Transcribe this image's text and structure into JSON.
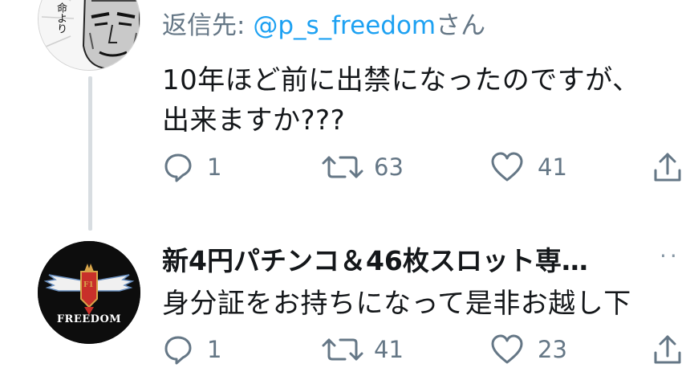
{
  "tweet1": {
    "reply_prefix": "返信先: ",
    "reply_mention": "@p_s_freedom",
    "reply_suffix": "さん",
    "avatar_text": "命より",
    "text_line1": "10年ほど前に出禁になったのですが、",
    "text_line2": "出来ますか???",
    "actions": {
      "reply_icon": "reply-icon",
      "reply_count": "1",
      "retweet_icon": "retweet-icon",
      "retweet_count": "63",
      "like_icon": "heart-icon",
      "like_count": "41",
      "share_icon": "share-icon"
    }
  },
  "tweet2": {
    "display_name": "新4円パチンコ＆46枚スロット専…",
    "text_line1": "身分証をお持ちになって是非お越し下",
    "avatar_text": "FREEDOM",
    "avatar_badge": "F1",
    "actions": {
      "reply_icon": "reply-icon",
      "reply_count": "1",
      "retweet_icon": "retweet-icon",
      "retweet_count": "41",
      "like_icon": "heart-icon",
      "like_count": "23",
      "share_icon": "share-icon"
    }
  },
  "colors": {
    "text_primary": "#14171a",
    "text_secondary": "#657786",
    "link_blue": "#1da1f2",
    "thread_line": "#d8dde1",
    "freedom_red": "#c8302a",
    "freedom_gold": "#d8a54a"
  }
}
